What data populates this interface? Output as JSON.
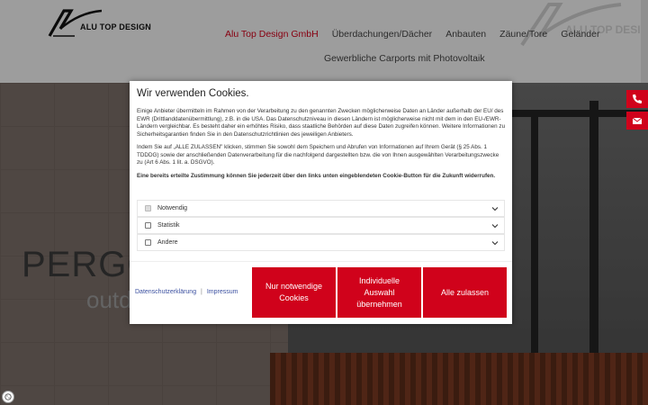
{
  "header": {
    "logo_text": "ALU TOP DESIGN",
    "watermark_text": "ALU TOP DESIGN",
    "nav": [
      {
        "label": "Alu Top Design GmbH",
        "active": true
      },
      {
        "label": "Überdachungen/Dächer",
        "active": false
      },
      {
        "label": "Anbauten",
        "active": false
      },
      {
        "label": "Zäune/Tore",
        "active": false
      },
      {
        "label": "Geländer",
        "active": false
      }
    ],
    "nav_second_row": "Gewerbliche Carports mit Photovoltaik"
  },
  "hero": {
    "title": "PERGO",
    "subtitle": "outd"
  },
  "side_buttons": [
    {
      "icon": "phone-icon"
    },
    {
      "icon": "mail-icon"
    }
  ],
  "cookie": {
    "title": "Wir verwenden Cookies.",
    "paragraph1": "Einige Anbieter übermitteln im Rahmen von der Verarbeitung zu den genannten Zwecken möglicherweise Daten an Länder außerhalb der EU/ des EWR (Drittlanddatenübermittlung), z.B. in die USA. Das Datenschutzniveau in diesen Ländern ist möglicherweise nicht mit dem in den EU-/EWR-Ländern vergleichbar. Es besteht daher ein erhöhtes Risiko, dass staatliche Behörden auf diese Daten zugreifen können. Weitere Informationen zu Sicherheitsgarantien finden Sie in den Datenschutzrichtlinien des jeweiligen Anbieters.",
    "paragraph2": "Indem Sie auf „ALLE ZULASSEN\" klicken, stimmen Sie sowohl dem Speichern und Abrufen von Informationen auf Ihrem Gerät (§ 25 Abs. 1 TDDDG) sowie der anschließenden Datenverarbeitung für die nachfolgend dargestellten bzw. die von Ihnen ausgewählten Verarbeitungszwecke zu (Art 6 Abs. 1 lit. a. DSGVO).",
    "paragraph3": "Eine bereits erteilte Zustimmung können Sie jederzeit über den links unten eingeblendeten Cookie-Button für die Zukunft widerrufen.",
    "categories": [
      {
        "label": "Notwendig",
        "checked": true,
        "disabled": true
      },
      {
        "label": "Statistik",
        "checked": false,
        "disabled": false
      },
      {
        "label": "Andere",
        "checked": false,
        "disabled": false
      }
    ],
    "links": {
      "privacy": "Datenschutzerklärung",
      "separator": "|",
      "imprint": "Impressum"
    },
    "buttons": {
      "necessary": "Nur notwendige Cookies",
      "individual": "Individuelle Auswahl übernehmen",
      "accept_all": "Alle zulassen"
    }
  },
  "colors": {
    "accent": "#d0021b",
    "link": "#3b50a0"
  }
}
